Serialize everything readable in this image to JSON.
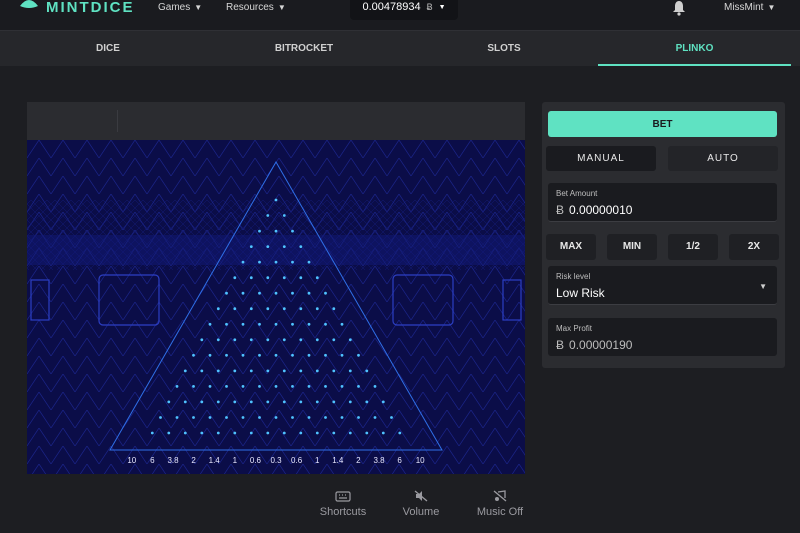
{
  "brand": {
    "name": "MINTDICE",
    "color": "#5fe2c2"
  },
  "nav": {
    "games_label": "Games",
    "resources_label": "Resources"
  },
  "wallet": {
    "balance": "0.00478934",
    "currency_symbol": "Ƀ"
  },
  "user": {
    "name": "MissMint"
  },
  "tabs": [
    {
      "label": "DICE",
      "active": false
    },
    {
      "label": "BITROCKET",
      "active": false
    },
    {
      "label": "SLOTS",
      "active": false
    },
    {
      "label": "PLINKO",
      "active": true
    }
  ],
  "plinko": {
    "rows": 16,
    "multipliers": [
      "10",
      "6",
      "3.8",
      "2",
      "1.4",
      "1",
      "0.6",
      "0.3",
      "0.6",
      "1",
      "1.4",
      "2",
      "3.8",
      "6",
      "10"
    ]
  },
  "bet_panel": {
    "bet_label": "BET",
    "modes": [
      {
        "label": "MANUAL",
        "active": true
      },
      {
        "label": "AUTO",
        "active": false
      }
    ],
    "bet_amount": {
      "label": "Bet Amount",
      "value": "0.00000010",
      "currency": "Ƀ"
    },
    "quick": [
      "MAX",
      "MIN",
      "1/2",
      "2X"
    ],
    "risk": {
      "label": "Risk level",
      "value": "Low Risk"
    },
    "max_profit": {
      "label": "Max Profit",
      "value": "0.00000190",
      "currency": "Ƀ"
    }
  },
  "controls": {
    "shortcuts": "Shortcuts",
    "volume": "Volume",
    "music": "Music Off"
  },
  "colors": {
    "accent": "#5fe2c2",
    "board_bg": "#0b0d48",
    "peg": "#4fc3ff"
  }
}
